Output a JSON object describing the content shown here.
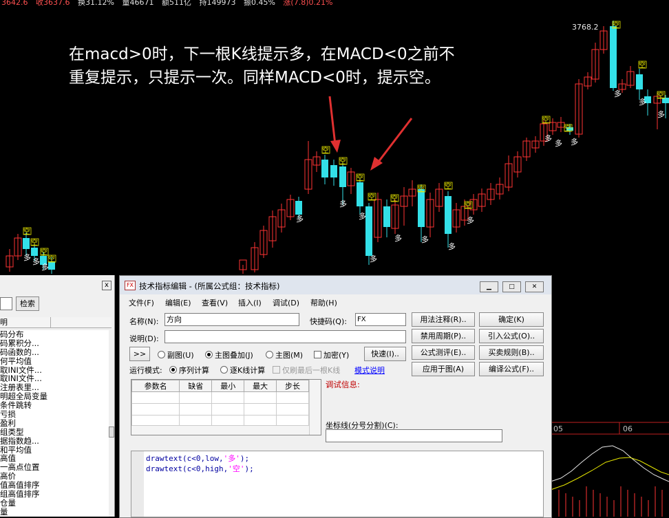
{
  "quote_bar": [
    "3642.6",
    "收3637.6",
    "换31.12%",
    "量46671",
    "额511亿",
    "持149973",
    "振0.45%",
    "涨(7.8)0.21%"
  ],
  "annotation": {
    "line1": "在macd>0时，下一根K线提示多，在MACD<0之前不",
    "line2": "重复提示，只提示一次。同样MACD<0时，提示空。"
  },
  "chart": {
    "peak_label": "3768.2",
    "buy_label": "多",
    "sell_label": "空",
    "date_ticks": [
      "05",
      "06"
    ],
    "up_color": "#ff3333",
    "down_color": "#33e0e8",
    "dif_color": "#e8e8e8",
    "dea_color": "#e8e800"
  },
  "left_panel": {
    "close": "x",
    "search_button": "检索",
    "column_header": "明",
    "items": [
      "码分布",
      "码累积分...",
      "码函数的...",
      "何平均值",
      "取INI文件...",
      "取INI文件...",
      "注册表里...",
      "明超全局变量",
      "条件跳转",
      "亏损",
      "盈利",
      "组类型",
      "据指数趋...",
      "和平均值",
      "高值",
      "一高点位置",
      "高价",
      "值高值排序",
      "组高值排序",
      "仓量",
      "量"
    ]
  },
  "dialog": {
    "icon": "FX",
    "title": "技术指标编辑 - (所属公式组：技术指标)",
    "win_buttons": [
      "▁",
      "□",
      "✕"
    ],
    "menu": [
      "文件(F)",
      "编辑(E)",
      "查看(V)",
      "插入(I)",
      "调试(D)",
      "帮助(H)"
    ],
    "name_label": "名称(N):",
    "name_value": "方向",
    "shortcut_label": "快捷码(Q):",
    "shortcut_value": "FX",
    "desc_label": "说明(D):",
    "desc_value": "",
    "expand_button": ">>",
    "radio_sub": "副图(U)",
    "radio_main_overlay": "主图叠加(J)",
    "radio_main": "主图(M)",
    "check_encrypt": "加密(Y)",
    "fast_button": "快速(I)..",
    "run_mode_label": "运行模式:",
    "run_seq": "序列计算",
    "run_kline": "逐K线计算",
    "refresh_last": "仅刷最后一根K线",
    "mode_link": "模式说明",
    "param_headers": [
      "参数名",
      "缺省",
      "最小",
      "最大",
      "步长"
    ],
    "debug_label": "调试信息:",
    "coord_label": "坐标线(分号分割)(C):",
    "buttons_col1": [
      "用法注释(R)..",
      "禁用周期(P)..",
      "公式测评(E)..",
      "应用于图(A)"
    ],
    "buttons_col2": [
      "确定(K)",
      "引入公式(O)..",
      "买卖规则(B)..",
      "编译公式(F).."
    ],
    "code_line1": {
      "prefix": "drawtext(c<0,low,",
      "str": "'多'",
      "suffix": ");"
    },
    "code_line2": {
      "prefix": "drawtext(c<0,high,",
      "str": "'空'",
      "suffix": ");"
    }
  }
}
